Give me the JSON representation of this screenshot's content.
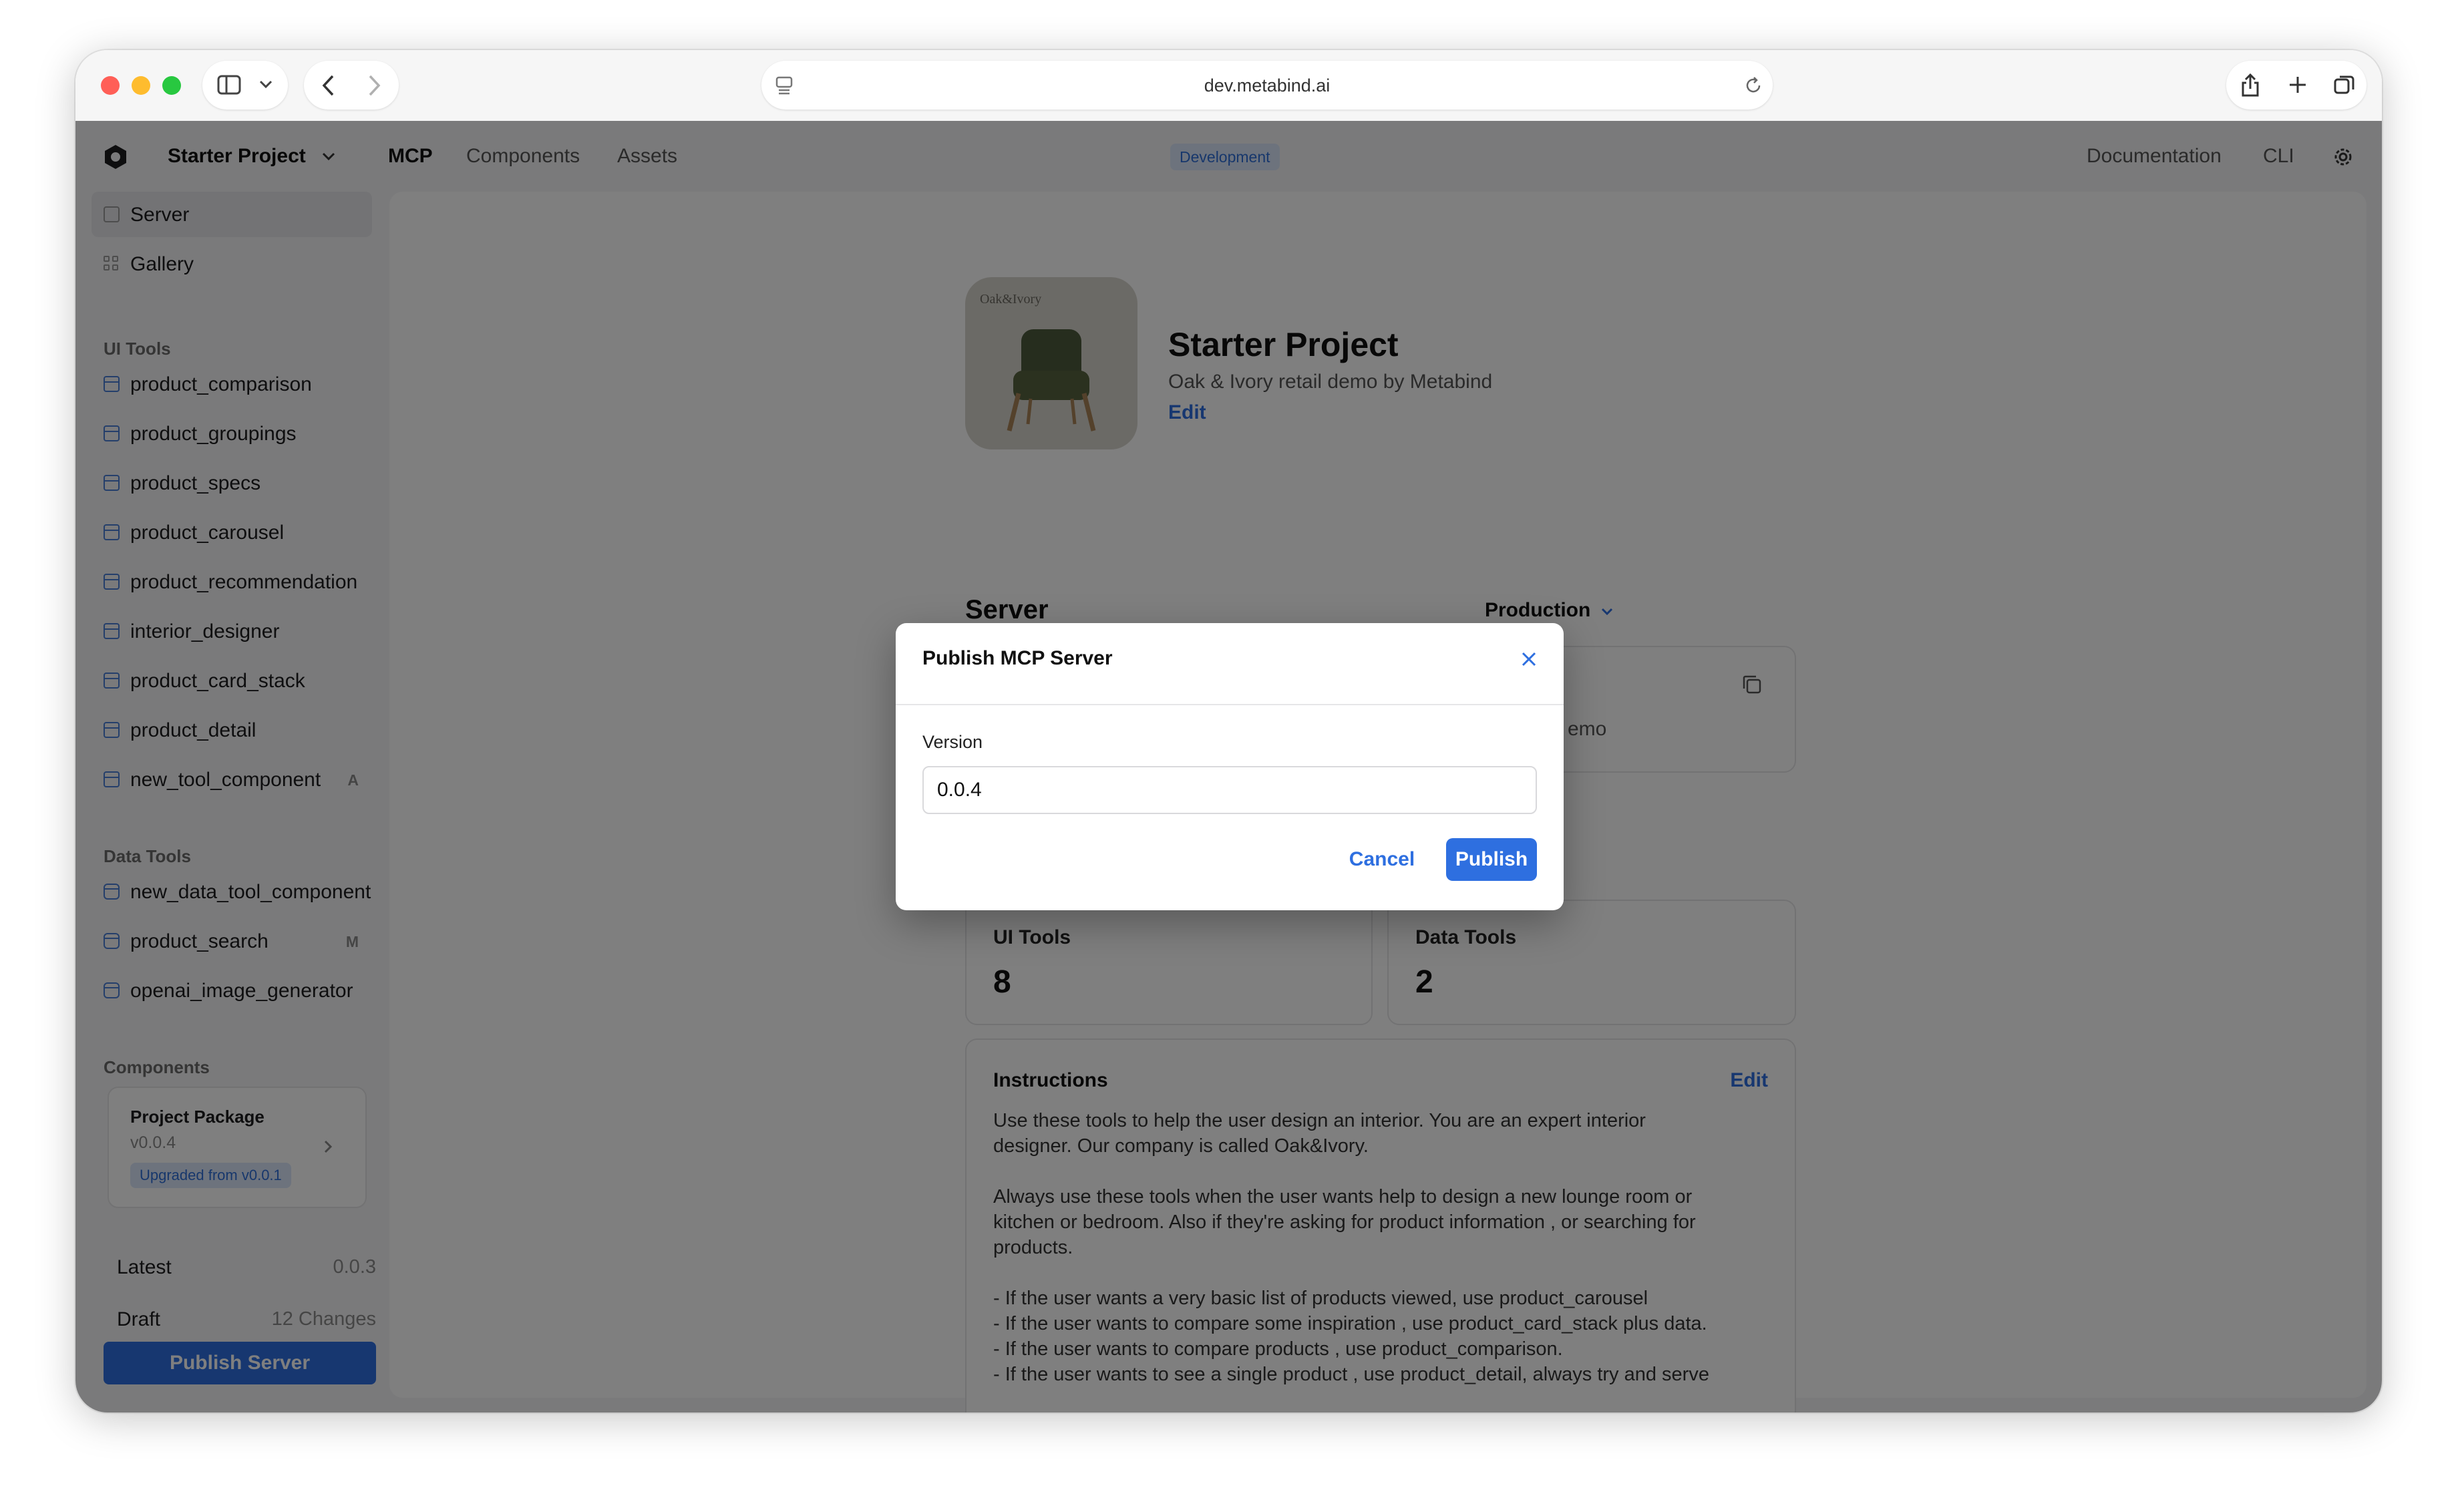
{
  "browser": {
    "url": "dev.metabind.ai"
  },
  "topnav": {
    "project_name": "Starter Project",
    "tabs": [
      "MCP",
      "Components",
      "Assets"
    ],
    "environment_badge": "Development",
    "right_links": [
      "Documentation",
      "CLI"
    ]
  },
  "sidebar": {
    "top_items": [
      {
        "label": "Server",
        "icon": "server-icon"
      },
      {
        "label": "Gallery",
        "icon": "grid-icon"
      }
    ],
    "ui_tools_title": "UI Tools",
    "ui_tools": [
      {
        "label": "product_comparison",
        "badge": ""
      },
      {
        "label": "product_groupings",
        "badge": ""
      },
      {
        "label": "product_specs",
        "badge": ""
      },
      {
        "label": "product_carousel",
        "badge": ""
      },
      {
        "label": "product_recommendation",
        "badge": ""
      },
      {
        "label": "interior_designer",
        "badge": ""
      },
      {
        "label": "product_card_stack",
        "badge": ""
      },
      {
        "label": "product_detail",
        "badge": ""
      },
      {
        "label": "new_tool_component",
        "badge": "A"
      }
    ],
    "data_tools_title": "Data Tools",
    "data_tools": [
      {
        "label": "new_data_tool_component",
        "badge": ""
      },
      {
        "label": "product_search",
        "badge": "M"
      },
      {
        "label": "openai_image_generator",
        "badge": ""
      }
    ],
    "components_title": "Components",
    "package": {
      "name": "Project Package",
      "version": "v0.0.4",
      "upgrade_note": "Upgraded from v0.0.1"
    },
    "latest_label": "Latest",
    "latest_value": "0.0.3",
    "draft_label": "Draft",
    "draft_value": "12 Changes",
    "publish_button": "Publish Server"
  },
  "main": {
    "logo_text": "Oak&Ivory",
    "project_title": "Starter Project",
    "project_subtitle": "Oak & Ivory retail demo by Metabind",
    "edit_link": "Edit",
    "server_heading": "Server",
    "env_select": "Production",
    "server_card_partial": "emo",
    "ui_tools_label": "UI Tools",
    "ui_tools_count": "8",
    "data_tools_label": "Data Tools",
    "data_tools_count": "2",
    "instructions_title": "Instructions",
    "instructions_edit": "Edit",
    "instructions_lines": [
      "Use these tools to help the user design an interior. You are an expert interior",
      "designer. Our company is called Oak&Ivory.",
      "",
      "Always use these tools when the user wants help to design a new lounge room or",
      "kitchen or bedroom. Also if they're asking for product information , or searching for",
      "products.",
      "",
      "- If the user wants a very basic list of products viewed, use product_carousel",
      "- If the user wants to compare some inspiration , use product_card_stack plus data.",
      "- If the user wants to compare products , use product_comparison.",
      "- If the user wants to see a single product , use product_detail, always try and serve"
    ]
  },
  "modal": {
    "title": "Publish MCP Server",
    "version_label": "Version",
    "version_value": "0.0.4",
    "cancel_label": "Cancel",
    "publish_label": "Publish"
  }
}
